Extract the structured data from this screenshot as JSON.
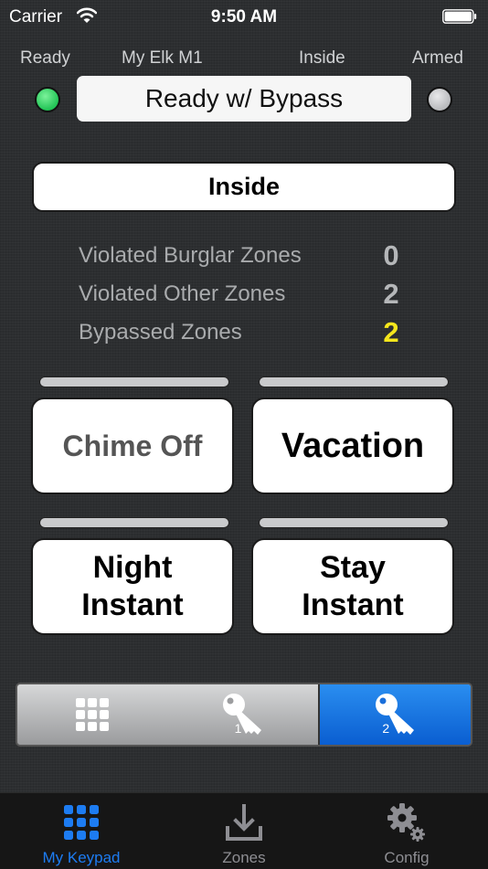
{
  "status_bar": {
    "carrier": "Carrier",
    "time": "9:50 AM"
  },
  "header": {
    "ready_label": "Ready",
    "panel_name": "My Elk M1",
    "area_label": "Inside",
    "armed_label": "Armed",
    "status_text": "Ready w/ Bypass",
    "ready_led_color": "#22c456",
    "armed_led_color": "#b8b9bc"
  },
  "mode_button": {
    "label": "Inside"
  },
  "zones": [
    {
      "label": "Violated Burglar Zones",
      "value": "0",
      "color": "#b5b7b9"
    },
    {
      "label": "Violated Other Zones",
      "value": "2",
      "color": "#b5b7b9"
    },
    {
      "label": "Bypassed Zones",
      "value": "2",
      "color": "#f5e61c"
    }
  ],
  "buttons": {
    "chime": "Chime Off",
    "vacation": "Vacation",
    "night_line1": "Night",
    "night_line2": "Instant",
    "stay_line1": "Stay",
    "stay_line2": "Instant"
  },
  "segmented": {
    "segments": [
      {
        "icon": "keypad-grid-icon"
      },
      {
        "icon": "key-icon",
        "number": "1"
      },
      {
        "icon": "key-icon",
        "number": "2"
      }
    ],
    "selected_index": 2,
    "accent": "#0a5ed1"
  },
  "tab_bar": {
    "tabs": [
      {
        "label": "My Keypad",
        "icon": "keypad-grid-icon"
      },
      {
        "label": "Zones",
        "icon": "download-tray-icon"
      },
      {
        "label": "Config",
        "icon": "gear-icon"
      }
    ],
    "active_index": 0,
    "active_color": "#1d7cf2"
  }
}
